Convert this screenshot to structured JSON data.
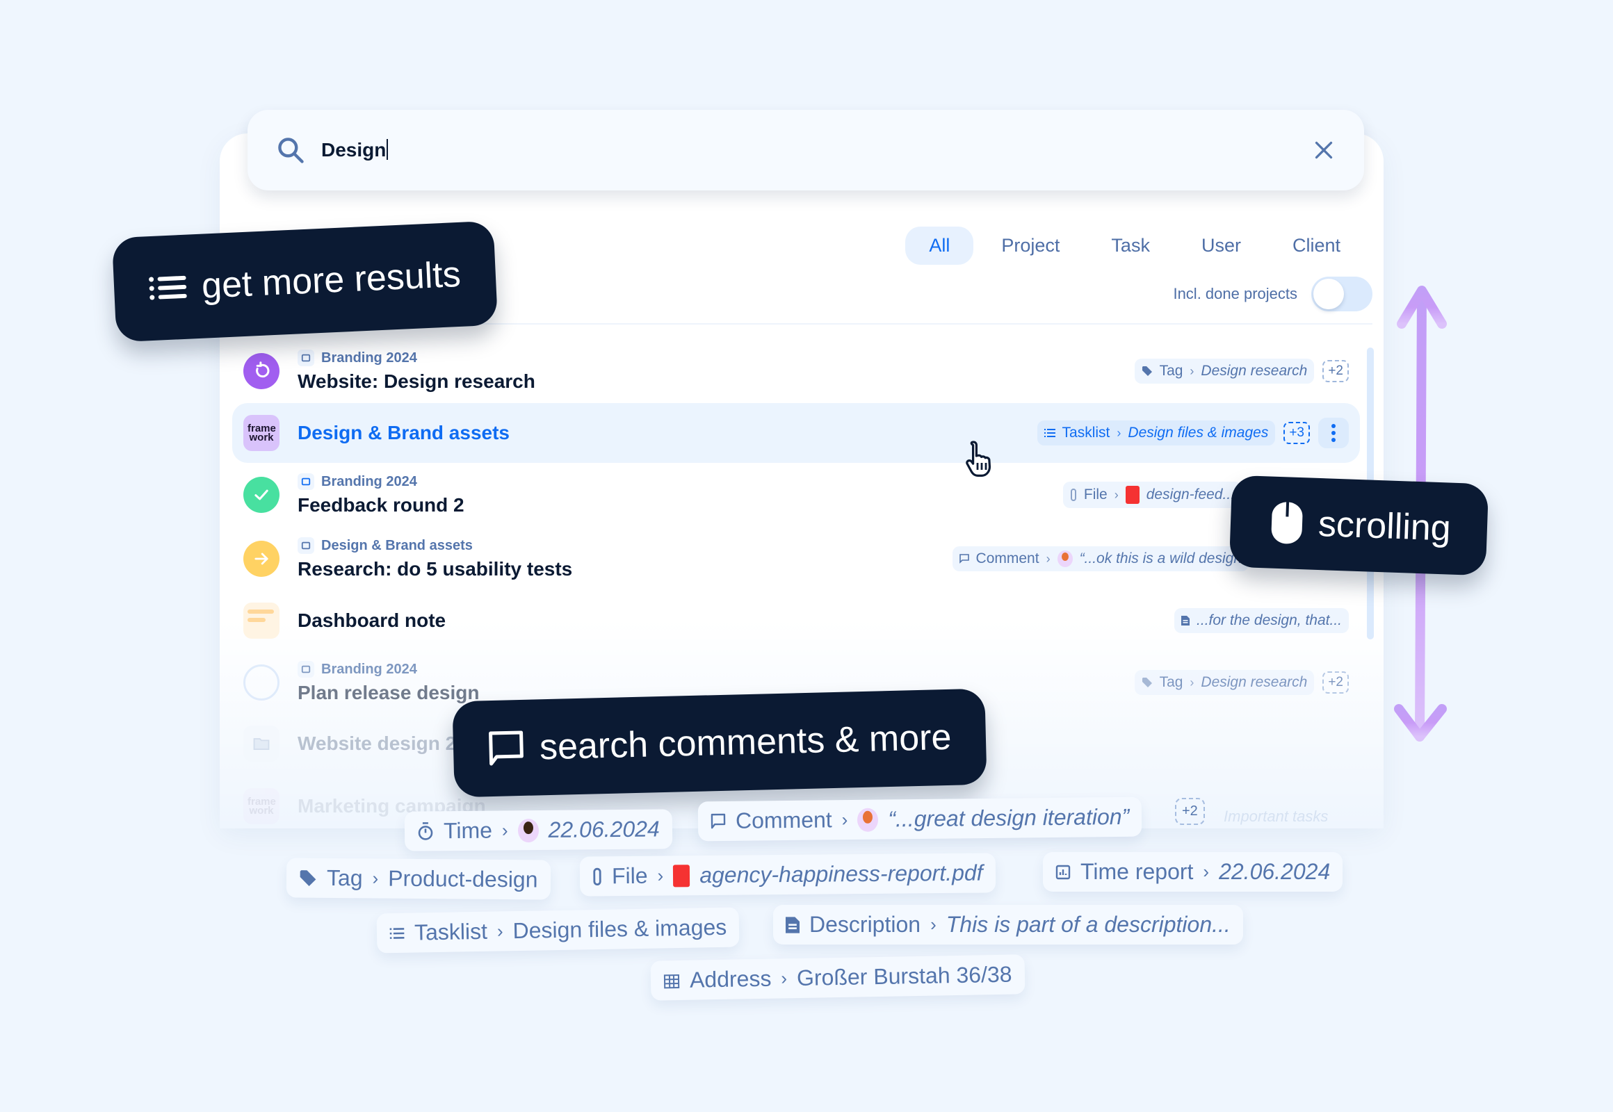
{
  "search": {
    "query": "Design",
    "clear_label": "clear search"
  },
  "filters": {
    "tabs": [
      {
        "label": "All",
        "active": true
      },
      {
        "label": "Project",
        "active": false
      },
      {
        "label": "Task",
        "active": false
      },
      {
        "label": "User",
        "active": false
      },
      {
        "label": "Client",
        "active": false
      }
    ],
    "toggle_label": "Incl. done projects",
    "toggle_on": false
  },
  "results": [
    {
      "type": "task",
      "status": "in-progress",
      "project": "Branding 2024",
      "title": "Website: Design research",
      "match": {
        "kind": "Tag",
        "value": "Design research",
        "more": "+2"
      }
    },
    {
      "type": "project",
      "status": "logo",
      "logo_text": "frame work",
      "title": "Design & Brand assets",
      "selected": true,
      "match": {
        "kind": "Tasklist",
        "value": "Design files & images",
        "more": "+3"
      }
    },
    {
      "type": "task",
      "status": "done",
      "project": "Branding 2024",
      "title": "Feedback round 2",
      "match": {
        "kind": "File",
        "value": "design-feed..."
      }
    },
    {
      "type": "task",
      "status": "next",
      "project": "Design & Brand assets",
      "title": "Research: do 5 usability tests",
      "match": {
        "kind": "Comment",
        "value": "“...ok this is a wild design"
      }
    },
    {
      "type": "note",
      "status": "note",
      "title": "Dashboard note",
      "match": {
        "kind": "",
        "value": "...for the design, that..."
      }
    },
    {
      "type": "task",
      "status": "open",
      "project": "Branding 2024",
      "title": "Plan release design",
      "match": {
        "kind": "Tag",
        "value": "Design research",
        "more": "+2"
      }
    },
    {
      "type": "project",
      "status": "folder",
      "title": "Website design 2024"
    },
    {
      "type": "project",
      "status": "logo",
      "logo_text": "frame work",
      "title": "Marketing campaign"
    }
  ],
  "callouts": {
    "more_results": "get more results",
    "scrolling": "scrolling",
    "comments": "search comments & more"
  },
  "floating_chips": {
    "time": {
      "kind": "Time",
      "value": "22.06.2024"
    },
    "comment": {
      "kind": "Comment",
      "value": "“...great design iteration”",
      "more": "+2"
    },
    "ghost": "Important tasks",
    "tag": {
      "kind": "Tag",
      "value": "Product-design"
    },
    "file": {
      "kind": "File",
      "value": "agency-happiness-report.pdf"
    },
    "time_report": {
      "kind": "Time report",
      "value": "22.06.2024"
    },
    "tasklist": {
      "kind": "Tasklist",
      "value": "Design files & images"
    },
    "description": {
      "kind": "Description",
      "value": "This is part of a description..."
    },
    "address": {
      "kind": "Address",
      "value": "Großer Burstah 36/38"
    }
  },
  "colors": {
    "background": "#eff6fe",
    "accent": "#0f6cf2",
    "callout": "#0b1a33",
    "muted_text": "#5475ac",
    "status_in_progress": "#a15ef0",
    "status_done": "#48e0a0",
    "status_next": "#ffd263",
    "scroll_arrow": "#c89cf7"
  }
}
